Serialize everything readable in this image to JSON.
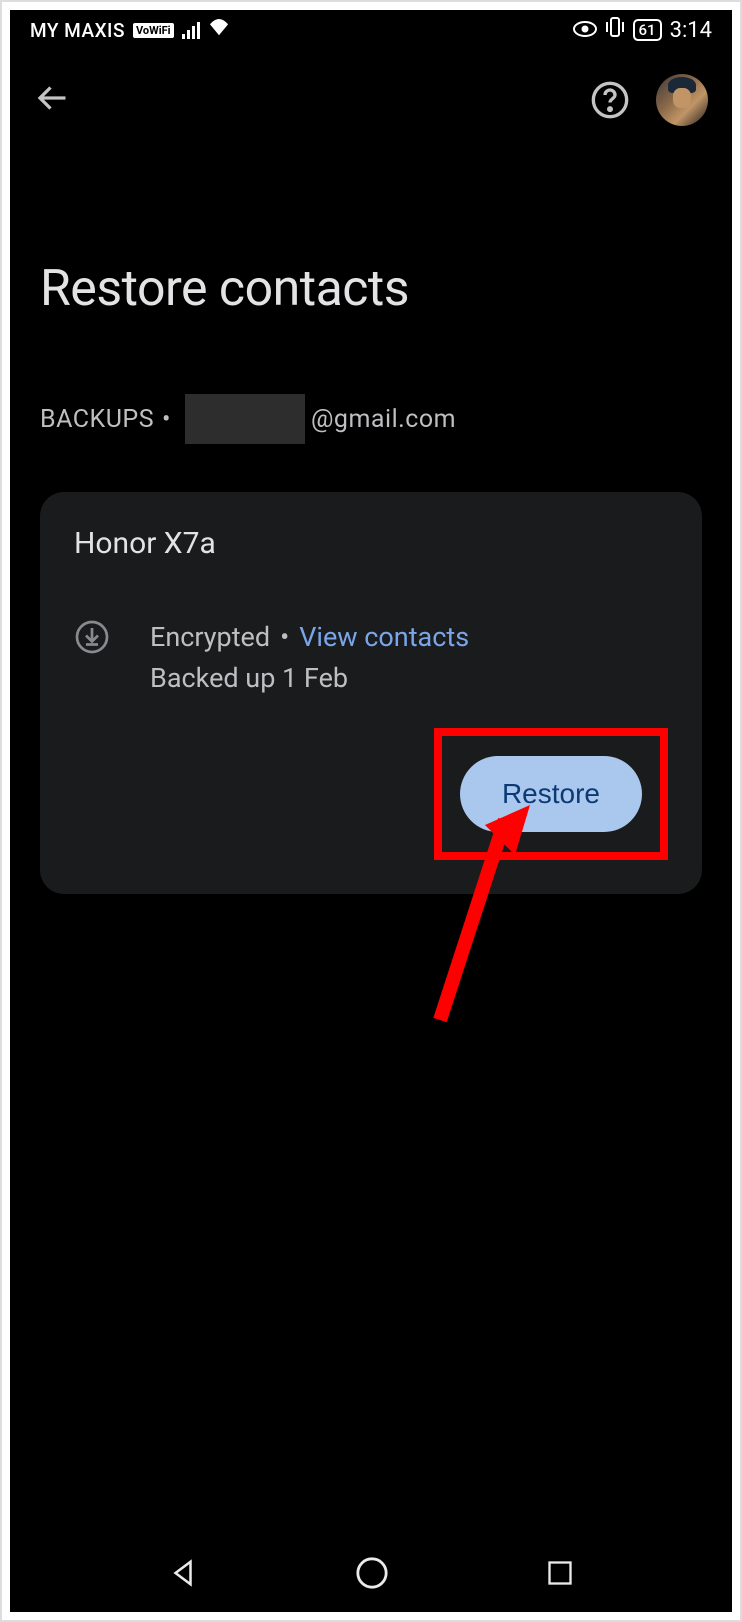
{
  "status_bar": {
    "carrier": "MY MAXIS",
    "vowifi": "VoWiFi",
    "battery_level": "61",
    "time": "3:14"
  },
  "page": {
    "title": "Restore contacts",
    "backups_label": "BACKUPS",
    "separator": "•",
    "email_suffix": "@gmail.com"
  },
  "backup_card": {
    "device_name": "Honor X7a",
    "encrypted_label": "Encrypted",
    "view_contacts_label": "View contacts",
    "backed_up_label": "Backed up 1 Feb",
    "restore_button": "Restore"
  }
}
